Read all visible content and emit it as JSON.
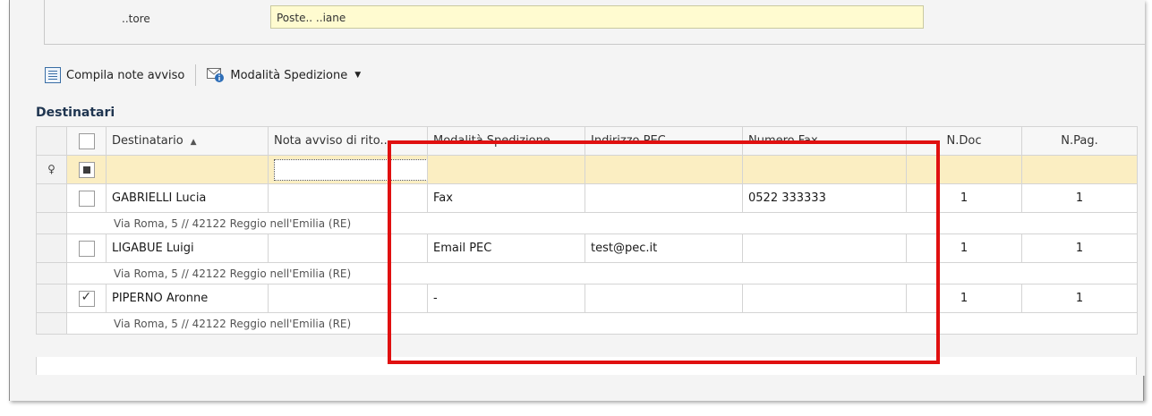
{
  "sender": {
    "label": "..tore",
    "value": "Poste.. ..iane"
  },
  "toolbar": {
    "compila_label": "Compila note avviso",
    "modalita_label": "Modalità Spedizione",
    "compila_icon": "notes-icon",
    "modalita_icon": "mail-info-icon"
  },
  "section_title": "Destinatari",
  "grid": {
    "columns": {
      "destinatario": "Destinatario",
      "nota": "Nota avviso di rito...",
      "modalita": "Modalità Spedizione",
      "pec": "Indirizzo PEC",
      "fax": "Numero Fax",
      "ndoc": "N.Doc",
      "npag": "N.Pag."
    },
    "rows": [
      {
        "checked": false,
        "destinatario": "GABRIELLI Lucia",
        "nota": "",
        "modalita": "Fax",
        "pec": "",
        "fax": "0522 333333",
        "ndoc": "1",
        "npag": "1",
        "address": "Via Roma, 5  // 42122 Reggio nell'Emilia (RE)"
      },
      {
        "checked": false,
        "destinatario": "LIGABUE Luigi",
        "nota": "",
        "modalita": "Email PEC",
        "pec": "test@pec.it",
        "fax": "",
        "ndoc": "1",
        "npag": "1",
        "address": "Via Roma, 5  // 42122 Reggio nell'Emilia (RE)"
      },
      {
        "checked": true,
        "destinatario": "PIPERNO Aronne",
        "nota": "",
        "modalita": "-",
        "pec": "",
        "fax": "",
        "ndoc": "1",
        "npag": "1",
        "address": "Via Roma, 5  // 42122 Reggio nell'Emilia (RE)"
      }
    ]
  },
  "colors": {
    "highlight": "#e01010",
    "filter_row": "#fbeec2",
    "sender_field": "#fffbd0"
  }
}
